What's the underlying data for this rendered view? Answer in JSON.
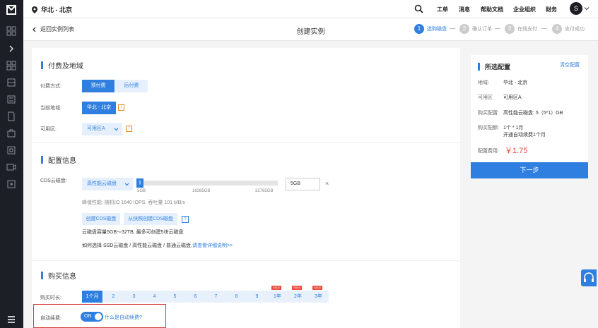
{
  "header": {
    "region": "华北 - 北京",
    "nav": [
      "工单",
      "消息",
      "帮助文档",
      "企业组织",
      "财务"
    ],
    "avatar_letter": "S"
  },
  "subheader": {
    "back_label": "返回实例列表",
    "title": "创建实例",
    "steps": [
      {
        "num": "1",
        "label": "选购磁盘"
      },
      {
        "num": "2",
        "label": "确认订单"
      },
      {
        "num": "3",
        "label": "在线支付"
      },
      {
        "num": "4",
        "label": "支付成功"
      }
    ]
  },
  "billing": {
    "section_title": "付费及地域",
    "pay_label": "付费方式:",
    "prepaid": "预付费",
    "postpaid": "后付费",
    "region_label": "当前地域:",
    "region_value": "华北 - 北京",
    "zone_label": "可用区:",
    "zone_value": "可用区A",
    "warn_glyph": "!"
  },
  "config": {
    "section_title": "配置信息",
    "cds_label": "CDS云磁盘:",
    "disk_type": "高性能云磁盘",
    "handle_glyph": "||",
    "ticks": [
      "5GB",
      "16385GB",
      "32765GB"
    ],
    "size_value": "5GB",
    "clear_glyph": "×",
    "perf_text": "峰值性能: 随机IO 1640 IOPS, 吞吐量 101 MB/s",
    "create_btn": "创建CDS磁盘",
    "snapshot_btn": "从快照创建CDS磁盘",
    "help_glyph": "?",
    "capacity_text": "云磁盘容量5GB～32TB, 最多可创建5块云磁盘",
    "howto_text": "如何选择 SSD云磁盘 / 高性能云磁盘 / 普通云磁盘,",
    "howto_link": "请查看详细说明>>"
  },
  "purchase": {
    "section_title": "购买信息",
    "duration_label": "购买时长:",
    "durations": [
      "1个月",
      "2",
      "3",
      "4",
      "5",
      "6",
      "7",
      "8",
      "9",
      "1年",
      "2年",
      "3年"
    ],
    "sale_badge": "SALE",
    "auto_label": "自动续费:",
    "toggle_on": "ON",
    "what_is_auto": "什么是自动续费?"
  },
  "summary": {
    "title": "所选配置",
    "clear": "清空配置",
    "rows": [
      {
        "label": "地域:",
        "value": "华北 - 北京"
      },
      {
        "label": "可用区",
        "value": "可用区A"
      },
      {
        "label": "购买配置:",
        "value": "高性能云磁盘: 5（5*1）GB"
      },
      {
        "label": "购买配额:",
        "value": "1个 * 1月"
      },
      {
        "label": "",
        "value": "开通自动续费1个月"
      }
    ],
    "price_label": "配置费用:",
    "price": "￥1.75",
    "next": "下一步"
  },
  "colors": {
    "accent": "#2f7fe0",
    "warn": "#e8891c",
    "sale": "#e74c3c",
    "highlight": "#d63c3c"
  }
}
